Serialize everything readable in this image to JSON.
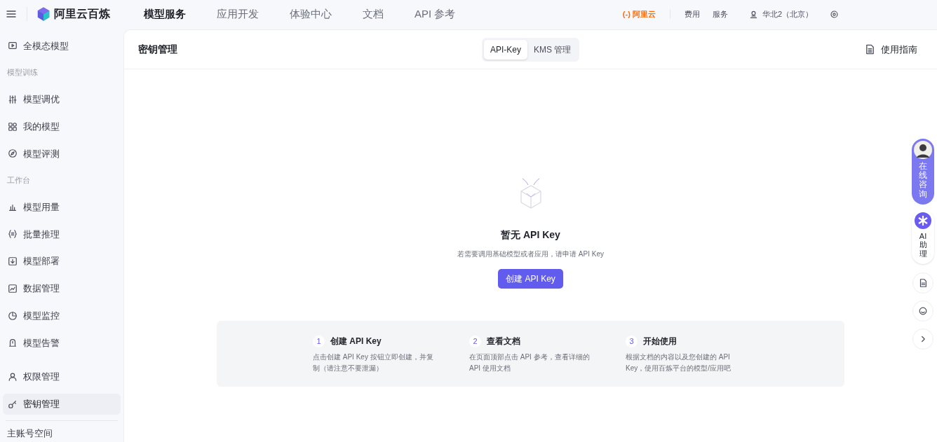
{
  "topbar": {
    "brand": "阿里云百炼",
    "nav": [
      {
        "label": "模型服务",
        "selected": true
      },
      {
        "label": "应用开发",
        "selected": false
      },
      {
        "label": "体验中心",
        "selected": false
      },
      {
        "label": "文档",
        "selected": false
      },
      {
        "label": "API 参考",
        "selected": false
      }
    ],
    "cloud_logo": "(-) 阿里云",
    "links": [
      "费用",
      "服务"
    ],
    "region": "华北2（北京）"
  },
  "sidebar": {
    "items": [
      {
        "kind": "item",
        "label": "全模态模型",
        "selected": false
      },
      {
        "kind": "section",
        "label": "模型训练"
      },
      {
        "kind": "item",
        "label": "模型调优",
        "selected": false
      },
      {
        "kind": "item",
        "label": "我的模型",
        "selected": false
      },
      {
        "kind": "item",
        "label": "模型评测",
        "selected": false
      },
      {
        "kind": "section",
        "label": "工作台"
      },
      {
        "kind": "item",
        "label": "模型用量",
        "selected": false
      },
      {
        "kind": "item",
        "label": "批量推理",
        "selected": false
      },
      {
        "kind": "item",
        "label": "模型部署",
        "selected": false
      },
      {
        "kind": "item",
        "label": "数据管理",
        "selected": false
      },
      {
        "kind": "item",
        "label": "模型监控",
        "selected": false
      },
      {
        "kind": "item",
        "label": "模型告警",
        "selected": false
      },
      {
        "kind": "gap"
      },
      {
        "kind": "item",
        "label": "权限管理",
        "selected": false
      },
      {
        "kind": "item",
        "label": "密钥管理",
        "selected": true
      }
    ],
    "footer": "主账号空间"
  },
  "page": {
    "title": "密钥管理",
    "tabs": [
      {
        "label": "API-Key",
        "selected": true
      },
      {
        "label": "KMS 管理",
        "selected": false
      }
    ],
    "guide": "使用指南"
  },
  "empty": {
    "title": "暂无 API Key",
    "text": "若需要调用基础模型或者应用，请申请 API Key",
    "button": "创建 API Key"
  },
  "steps": [
    {
      "number": "1",
      "title": "创建 API Key",
      "text": "点击创建 API Key 按钮立即创建，并复制（请注意不要泄漏）"
    },
    {
      "number": "2",
      "title": "查看文档",
      "text": "在页面顶部点击 API 参考，查看详细的 API 使用文档"
    },
    {
      "number": "3",
      "title": "开始使用",
      "text": "根据文档的内容以及您创建的 API Key，使用百炼平台的模型/应用吧"
    }
  ],
  "float": {
    "consult": "在线咨询",
    "assistant": "AI助理"
  }
}
